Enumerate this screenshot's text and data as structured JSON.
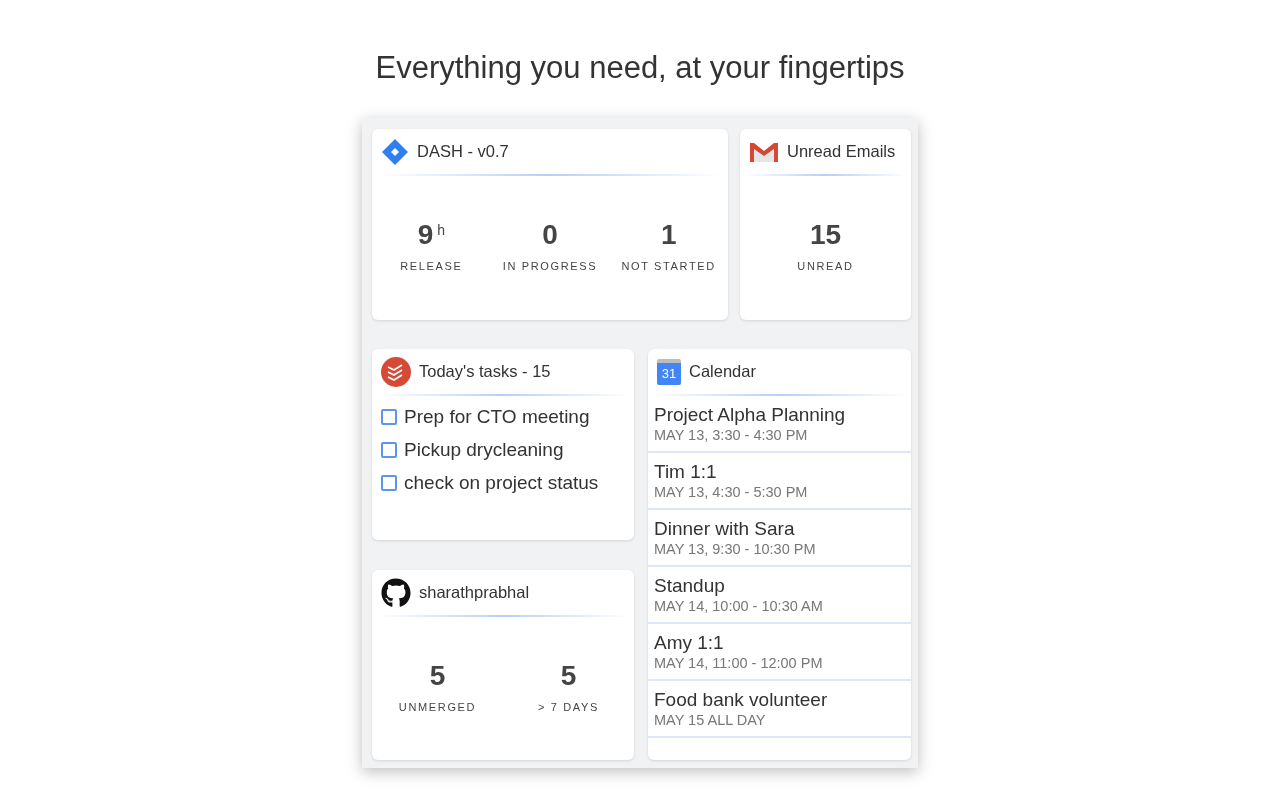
{
  "heading": "Everything you need, at your fingertips",
  "jira": {
    "title": "DASH - v0.7",
    "stats": [
      {
        "value": "9",
        "unit": "h",
        "label": "RELEASE"
      },
      {
        "value": "0",
        "label": "IN PROGRESS"
      },
      {
        "value": "1",
        "label": "NOT STARTED"
      }
    ]
  },
  "gmail": {
    "title": "Unread Emails",
    "stats": [
      {
        "value": "15",
        "label": "UNREAD"
      }
    ]
  },
  "tasks": {
    "title": "Today's tasks - 15",
    "items": [
      {
        "text": "Prep for CTO meeting",
        "checked": false
      },
      {
        "text": "Pickup drycleaning",
        "checked": false
      },
      {
        "text": "check on project status",
        "checked": false
      }
    ]
  },
  "calendar": {
    "title": "Calendar",
    "icon_label": "31",
    "events": [
      {
        "title": "Project Alpha Planning",
        "time": "MAY 13, 3:30 - 4:30 PM"
      },
      {
        "title": "Tim 1:1",
        "time": "MAY 13, 4:30 - 5:30 PM"
      },
      {
        "title": "Dinner with Sara",
        "time": "MAY 13, 9:30 - 10:30 PM"
      },
      {
        "title": "Standup",
        "time": "MAY 14, 10:00 - 10:30 AM"
      },
      {
        "title": "Amy 1:1",
        "time": "MAY 14, 11:00 - 12:00 PM"
      },
      {
        "title": "Food bank volunteer",
        "time": "MAY 15 ALL DAY"
      }
    ]
  },
  "github": {
    "title": "sharathprabhal",
    "stats": [
      {
        "value": "5",
        "label": "UNMERGED"
      },
      {
        "value": "5",
        "label": "> 7 DAYS"
      }
    ]
  }
}
